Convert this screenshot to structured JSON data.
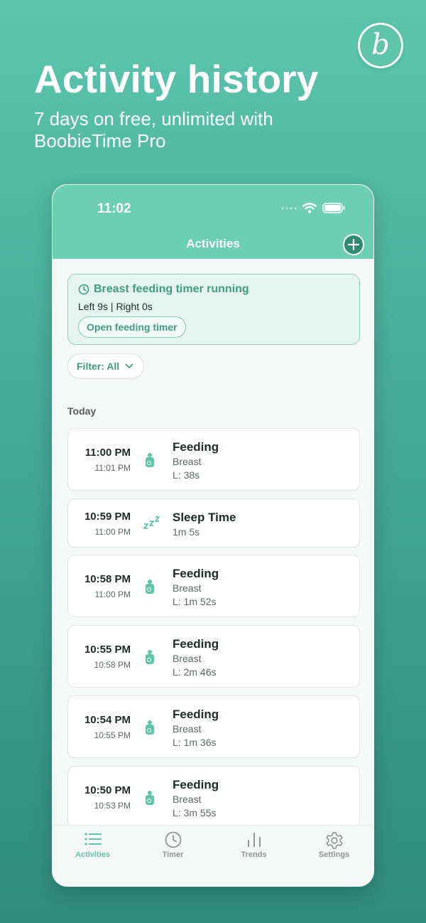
{
  "promo": {
    "logo_letter": "b",
    "headline": "Activity history",
    "subline": "7 days on free, unlimited with BoobieTime Pro"
  },
  "status_bar": {
    "time": "11:02"
  },
  "nav": {
    "title": "Activities",
    "add_icon": "plus-circle-icon"
  },
  "timer_banner": {
    "title": "Breast feeding timer running",
    "detail": "Left 9s | Right 0s",
    "button": "Open feeding timer",
    "icon": "clock-icon"
  },
  "filter": {
    "label": "Filter: All",
    "icon": "chevron-down-icon"
  },
  "section": {
    "label": "Today"
  },
  "activities": [
    {
      "start": "11:00 PM",
      "end": "11:01 PM",
      "icon": "feeding-icon",
      "title": "Feeding",
      "line1": "Breast",
      "line2": "L: 38s"
    },
    {
      "start": "10:59 PM",
      "end": "11:00 PM",
      "icon": "sleep-icon",
      "title": "Sleep Time",
      "line1": "1m 5s",
      "line2": ""
    },
    {
      "start": "10:58 PM",
      "end": "11:00 PM",
      "icon": "feeding-icon",
      "title": "Feeding",
      "line1": "Breast",
      "line2": "L: 1m 52s"
    },
    {
      "start": "10:55 PM",
      "end": "10:58 PM",
      "icon": "feeding-icon",
      "title": "Feeding",
      "line1": "Breast",
      "line2": "L: 2m 46s"
    },
    {
      "start": "10:54 PM",
      "end": "10:55 PM",
      "icon": "feeding-icon",
      "title": "Feeding",
      "line1": "Breast",
      "line2": "L: 1m 36s"
    },
    {
      "start": "10:50 PM",
      "end": "10:53 PM",
      "icon": "feeding-icon",
      "title": "Feeding",
      "line1": "Breast",
      "line2": "L: 3m 55s"
    }
  ],
  "tabs": [
    {
      "label": "Activities",
      "icon": "list-icon",
      "active": true
    },
    {
      "label": "Timer",
      "icon": "clock-icon",
      "active": false
    },
    {
      "label": "Trends",
      "icon": "bar-chart-icon",
      "active": false
    },
    {
      "label": "Settings",
      "icon": "gear-icon",
      "active": false
    }
  ],
  "colors": {
    "accent": "#5fc4a9",
    "header": "#6ccfb2",
    "banner_text": "#3f9d82",
    "background_top": "#5cc6ad",
    "background_bottom": "#2f8c7e"
  }
}
